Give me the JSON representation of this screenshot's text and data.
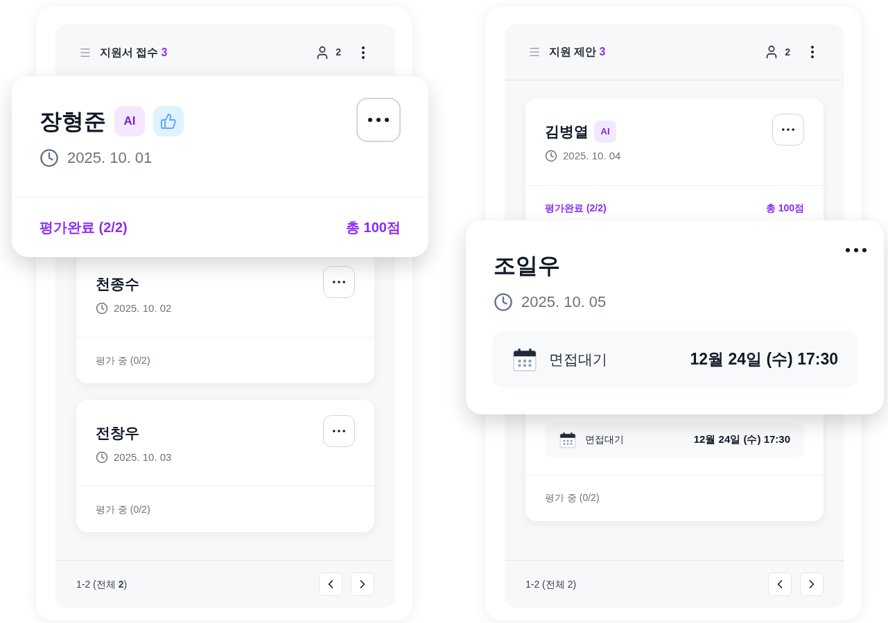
{
  "columns": [
    {
      "title": "지원서 접수",
      "count": "3",
      "members": "2",
      "featured_card": {
        "name": "장형준",
        "menu_bordered": true,
        "badges": [
          {
            "kind": "ai",
            "label": "AI"
          },
          {
            "kind": "like"
          }
        ],
        "date": "2025. 10. 01",
        "status": {
          "kind": "done",
          "text": "평가완료 (2/2)",
          "score": "총 100점"
        }
      },
      "cards": [
        {
          "name": "천종수",
          "date": "2025. 10. 02",
          "status": {
            "kind": "pending",
            "text": "평가 중 (0/2)"
          }
        },
        {
          "name": "전창우",
          "date": "2025. 10. 03",
          "status": {
            "kind": "pending",
            "text": "평가 중 (0/2)"
          }
        }
      ],
      "pager": "1-2 (전체 **2**)"
    },
    {
      "title": "지원 제안",
      "count": "3",
      "members": "2",
      "featured_card": {
        "name": "조일우",
        "menu_bordered": false,
        "date": "2025. 10. 05",
        "interview": {
          "label": "면접대기",
          "time": "12월 24일 (수) 17:30"
        }
      },
      "cards": [
        {
          "name": "김병열",
          "badges": [
            {
              "kind": "ai",
              "label": "AI"
            }
          ],
          "date": "2025. 10. 04",
          "status": {
            "kind": "done",
            "text": "평가완료 (2/2)",
            "score": "총 100점"
          }
        },
        {
          "interview": {
            "label": "면접대기",
            "time": "12월 24일 (수) 17:30"
          },
          "status": {
            "kind": "pending",
            "text": "평가 중 (0/2)"
          }
        }
      ],
      "pager": "1-2 (전체 2)"
    }
  ]
}
